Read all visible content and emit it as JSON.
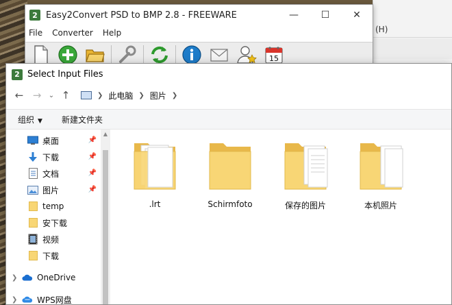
{
  "app": {
    "title": "Easy2Convert PSD to BMP 2.8 - FREEWARE",
    "logo": "2",
    "menu": [
      "File",
      "Converter",
      "Help"
    ],
    "toolbar_icons": [
      "new-file-icon",
      "add-icon",
      "open-folder-icon",
      "wrench-icon",
      "convert-icon",
      "info-icon",
      "mail-icon",
      "user-icon",
      "calendar-icon"
    ],
    "calendar_day": "15"
  },
  "back_window": {
    "fragment": "(H)"
  },
  "dialog": {
    "title": "Select Input Files",
    "logo": "2",
    "breadcrumb": [
      "此电脑",
      "图片"
    ],
    "commands": {
      "organize": "组织",
      "new_folder": "新建文件夹"
    },
    "nav_items": [
      {
        "label": "桌面",
        "icon": "desktop-icon",
        "pinned": true
      },
      {
        "label": "下载",
        "icon": "download-icon",
        "pinned": true
      },
      {
        "label": "文档",
        "icon": "document-icon",
        "pinned": true
      },
      {
        "label": "图片",
        "icon": "pictures-icon",
        "pinned": true
      },
      {
        "label": "temp",
        "icon": "folder-icon",
        "pinned": false
      },
      {
        "label": "安下载",
        "icon": "folder-icon",
        "pinned": false
      },
      {
        "label": "视频",
        "icon": "video-icon",
        "pinned": false
      },
      {
        "label": "下载",
        "icon": "folder-icon",
        "pinned": false
      },
      {
        "label": "OneDrive",
        "icon": "cloud-icon",
        "pinned": false
      },
      {
        "label": "WPS网盘",
        "icon": "wps-cloud-icon",
        "pinned": false
      }
    ],
    "files": [
      {
        "label": ".lrt",
        "type": "folder-with-doc"
      },
      {
        "label": "Schirmfoto",
        "type": "folder-empty"
      },
      {
        "label": "保存的图片",
        "type": "folder-with-docs"
      },
      {
        "label": "本机照片",
        "type": "folder-with-doc"
      }
    ]
  },
  "colors": {
    "folder": "#f8d675",
    "folder_dark": "#e8b84a",
    "accent": "#0078d7"
  }
}
